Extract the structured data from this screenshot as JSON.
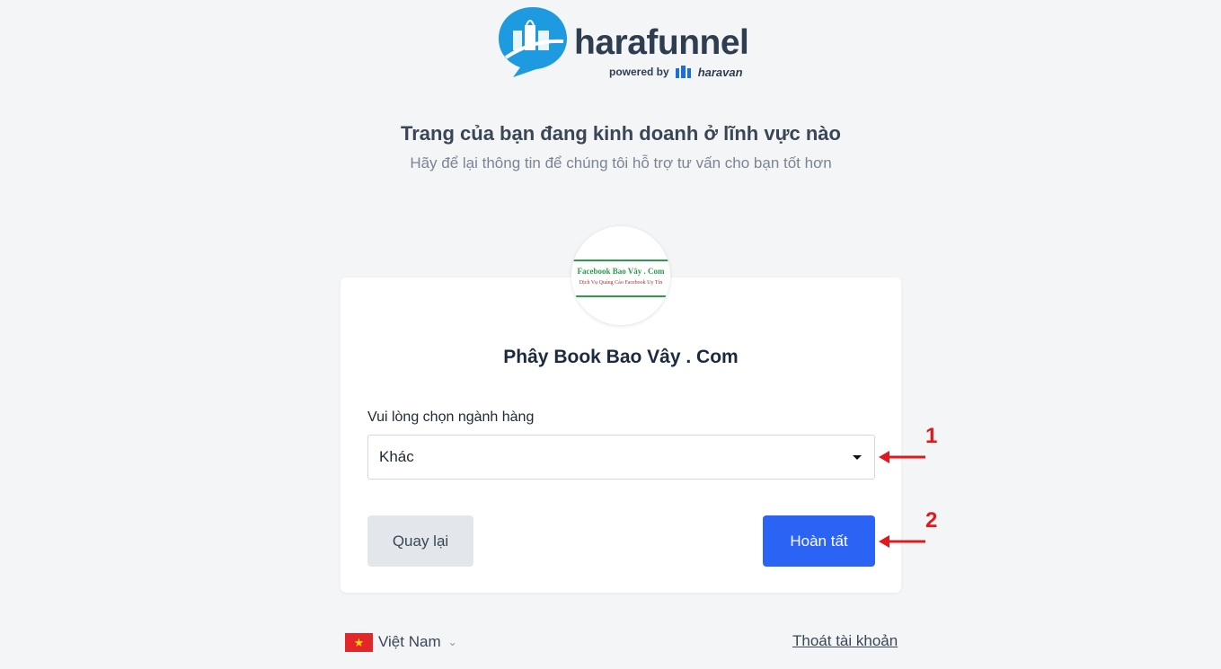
{
  "brand": {
    "name": "harafunnel",
    "powered_by": "powered by",
    "parent_brand": "haravan",
    "color": "#1e9be0"
  },
  "header": {
    "title": "Trang của bạn đang kinh doanh ở lĩnh vực nào",
    "subtitle": "Hãy để lại thông tin để chúng tôi hỗ trợ tư vấn cho bạn tốt hơn"
  },
  "page": {
    "avatar_line1": "Facebook Bao Vây . Com",
    "avatar_line2": "Dịch Vụ Quảng Cáo Facebook Uy Tín",
    "name": "Phây Book Bao Vây . Com"
  },
  "form": {
    "industry_label": "Vui lòng chọn ngành hàng",
    "industry_value": "Khác",
    "back_label": "Quay lại",
    "done_label": "Hoàn tất",
    "done_color": "#2b63f5"
  },
  "annotations": {
    "step1": "1",
    "step2": "2",
    "color": "#e0191f"
  },
  "footer": {
    "language": "Việt Nam",
    "flag_icon": "vietnam-flag-icon",
    "logout_label": "Thoát tài khoản"
  }
}
